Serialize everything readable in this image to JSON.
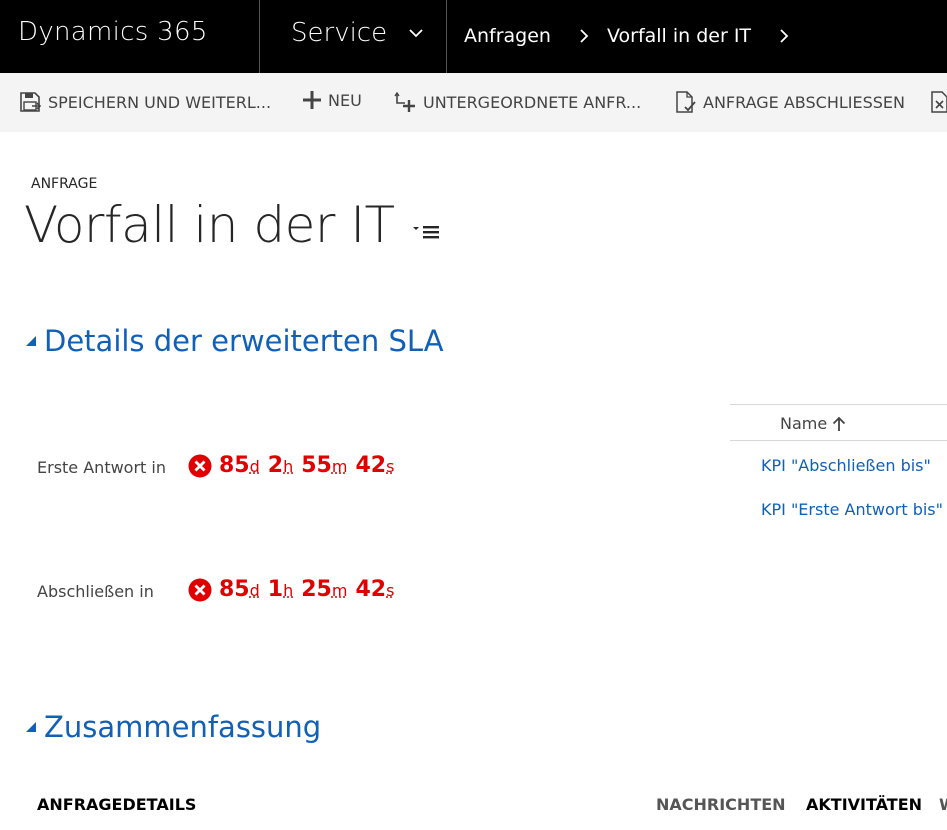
{
  "nav": {
    "brand": "Dynamics 365",
    "module": "Service",
    "breadcrumbs": [
      "Anfragen",
      "Vorfall in der IT"
    ]
  },
  "commands": {
    "save": "SPEICHERN UND WEITERL...",
    "new": "NEU",
    "child": "UNTERGEORDNETE ANFR...",
    "resolve": "ANFRAGE ABSCHLIESSEN"
  },
  "entity": {
    "type": "ANFRAGE",
    "title": "Vorfall in der IT"
  },
  "sla_section": {
    "title": "Details der erweiterten SLA",
    "first_response": {
      "label": "Erste Antwort in",
      "days": "85",
      "d": "d",
      "hours": "2",
      "h": "h",
      "minutes": "55",
      "m": "m",
      "seconds": "42",
      "s": "s"
    },
    "resolve_by": {
      "label": "Abschließen in",
      "days": "85",
      "d": "d",
      "hours": "1",
      "h": "h",
      "minutes": "25",
      "m": "m",
      "seconds": "42",
      "s": "s"
    },
    "grid": {
      "column": "Name",
      "rows": [
        "KPI \"Abschließen bis\"",
        "KPI \"Erste Antwort bis\""
      ]
    }
  },
  "summary_section": {
    "title": "Zusammenfassung",
    "details_label": "ANFRAGEDETAILS",
    "tabs": [
      "NACHRICHTEN",
      "AKTIVITÄTEN",
      "W"
    ]
  },
  "colors": {
    "nav_bg": "#000000",
    "accent_blue": "#1160b7",
    "error_red": "#e00000",
    "cmdbar_bg": "#f4f4f4"
  }
}
